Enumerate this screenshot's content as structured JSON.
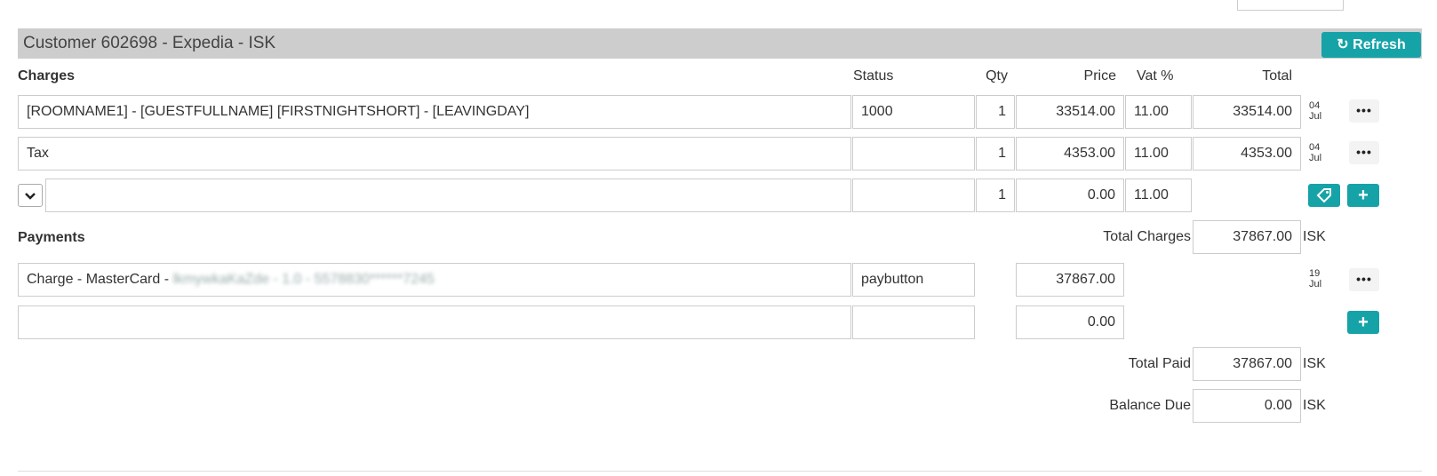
{
  "customer": {
    "title": "Customer 602698 - Expedia - ISK",
    "refresh_label": "Refresh"
  },
  "charges": {
    "headers": {
      "charges": "Charges",
      "status": "Status",
      "qty": "Qty",
      "price": "Price",
      "vat": "Vat %",
      "total": "Total"
    },
    "rows": [
      {
        "description": "[ROOMNAME1] - [GUESTFULLNAME] [FIRSTNIGHTSHORT] - [LEAVINGDAY]",
        "status": "1000",
        "qty": "1",
        "price": "33514.00",
        "vat": "11.00",
        "total": "33514.00",
        "date_day": "04",
        "date_month": "Jul"
      },
      {
        "description": "Tax",
        "status": "",
        "qty": "1",
        "price": "4353.00",
        "vat": "11.00",
        "total": "4353.00",
        "date_day": "04",
        "date_month": "Jul"
      }
    ],
    "new_row": {
      "qty": "1",
      "price": "0.00",
      "vat": "11.00"
    },
    "total_label": "Total Charges",
    "total_value": "37867.00",
    "currency": "ISK"
  },
  "payments": {
    "header": "Payments",
    "rows": [
      {
        "description_prefix": "Charge - MasterCard - ",
        "description_blurred": "lkmywkaKaZde - 1.0 - 5578830******7245",
        "status": "paybutton",
        "amount": "37867.00",
        "date_day": "19",
        "date_month": "Jul"
      }
    ],
    "new_row": {
      "amount": "0.00"
    },
    "total_paid_label": "Total Paid",
    "total_paid_value": "37867.00",
    "balance_label": "Balance Due",
    "balance_value": "0.00",
    "currency": "ISK"
  },
  "icons": {
    "refresh": "refresh-icon",
    "more": "more-icon",
    "tag": "tag-icon",
    "add": "plus-icon",
    "dropdown": "chevron-down-icon"
  },
  "colors": {
    "accent": "#16a3a8",
    "header_bar": "#cdcdcd"
  }
}
